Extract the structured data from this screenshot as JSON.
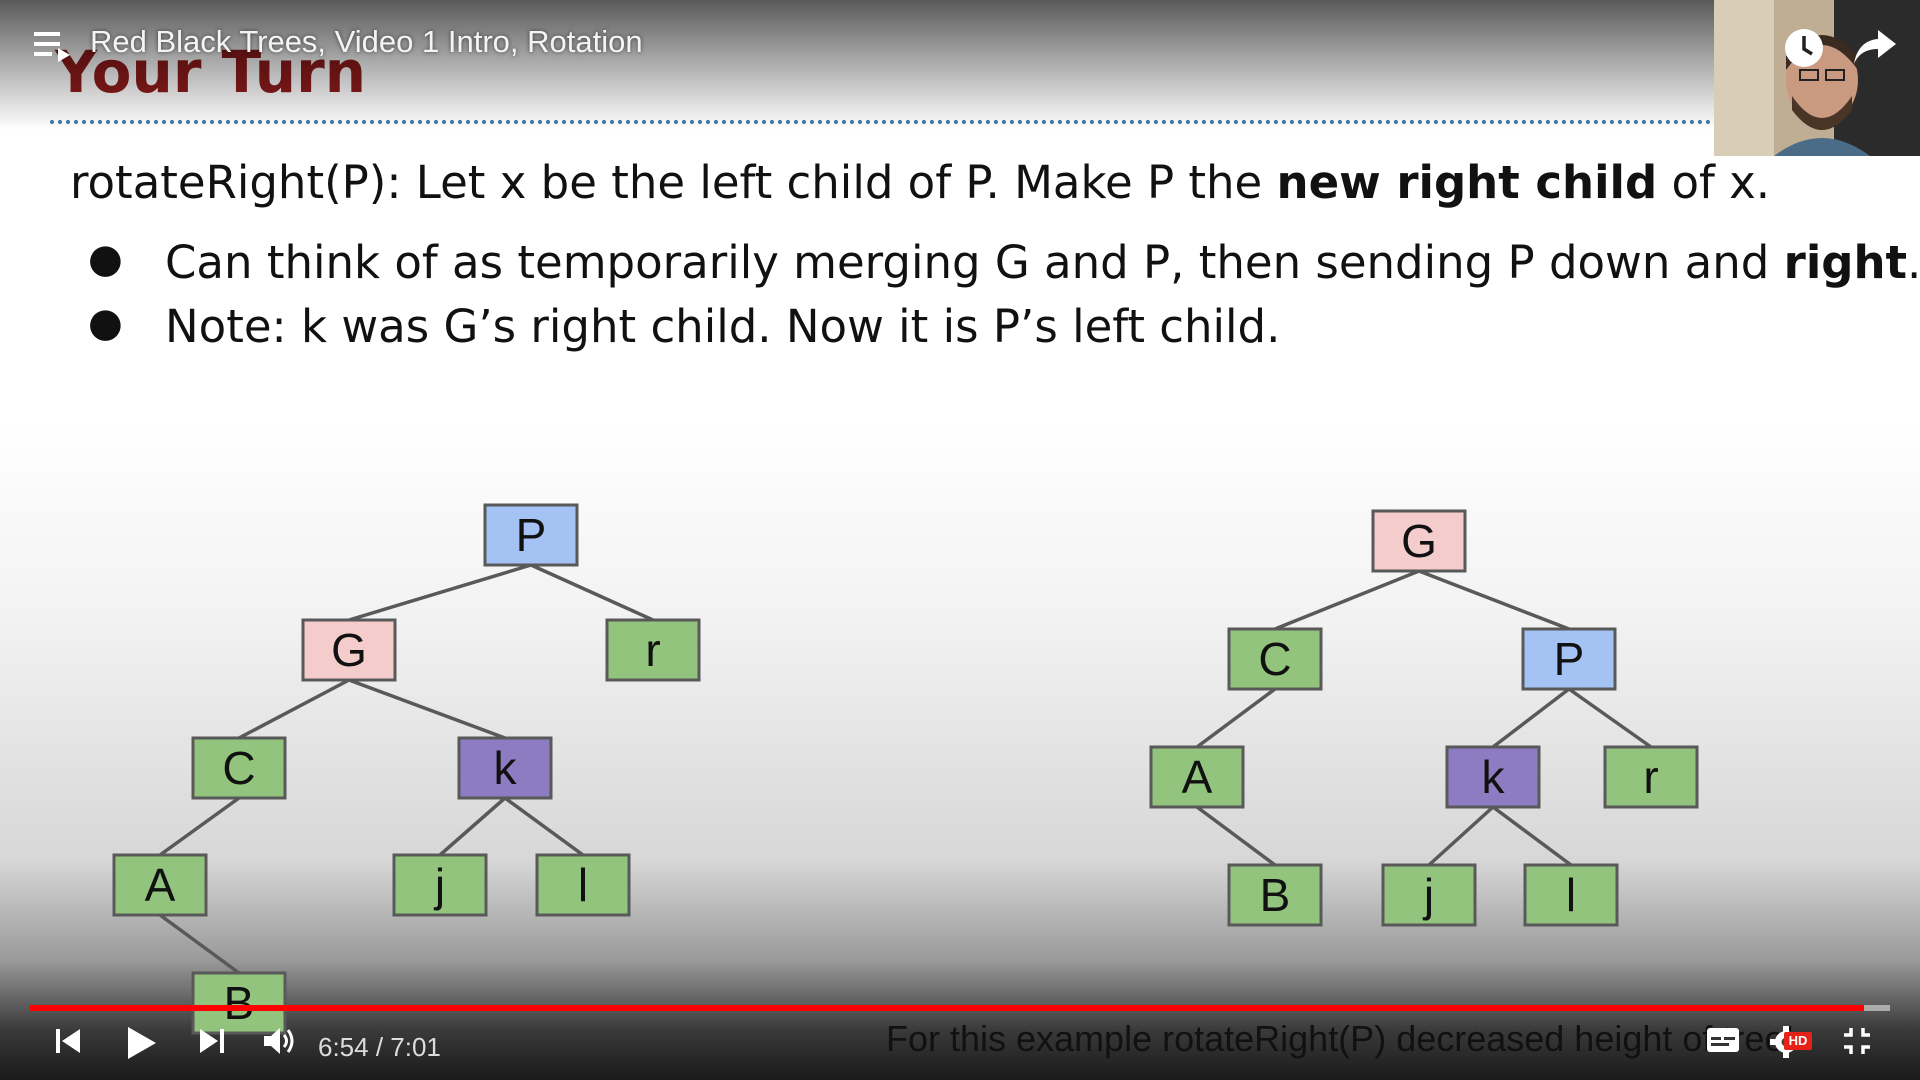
{
  "player": {
    "video_title": "Red Black Trees, Video 1 Intro, Rotation",
    "time_display": "6:54 / 7:01",
    "progress_fraction": 0.9858,
    "hd_badge": "HD",
    "caption": "For this example rotateRight(P) decreased height of tree!",
    "accent_color": "#ff0000"
  },
  "slide": {
    "heading": "Your Turn",
    "main_line": {
      "pre": "rotateRight(P): Let x be the left child of P. Make P the ",
      "bold": "new right child",
      "post": " of x."
    },
    "bullets": [
      {
        "pre": "Can think of as temporarily merging G and P, then sending P down and ",
        "bold": "right",
        "post": "."
      },
      {
        "pre": "Note: k was G’s right child. Now it is P’s left child.",
        "bold": "",
        "post": ""
      }
    ],
    "bullet_glyph": "●"
  },
  "trees": {
    "colors": {
      "blue": "#a4c2f4",
      "pink": "#f4cccc",
      "green": "#93c47d",
      "purple": "#8e7cc3"
    },
    "before": {
      "nodes": [
        {
          "id": "P",
          "label": "P",
          "color": "blue"
        },
        {
          "id": "G",
          "label": "G",
          "color": "pink"
        },
        {
          "id": "r",
          "label": "r",
          "color": "green"
        },
        {
          "id": "C",
          "label": "C",
          "color": "green"
        },
        {
          "id": "k",
          "label": "k",
          "color": "purple"
        },
        {
          "id": "A",
          "label": "A",
          "color": "green"
        },
        {
          "id": "j",
          "label": "j",
          "color": "green"
        },
        {
          "id": "l",
          "label": "l",
          "color": "green"
        },
        {
          "id": "B",
          "label": "B",
          "color": "green"
        }
      ],
      "edges": [
        [
          "P",
          "G"
        ],
        [
          "P",
          "r"
        ],
        [
          "G",
          "C"
        ],
        [
          "G",
          "k"
        ],
        [
          "C",
          "A"
        ],
        [
          "k",
          "j"
        ],
        [
          "k",
          "l"
        ],
        [
          "A",
          "B"
        ]
      ]
    },
    "after": {
      "nodes": [
        {
          "id": "G",
          "label": "G",
          "color": "pink"
        },
        {
          "id": "C",
          "label": "C",
          "color": "green"
        },
        {
          "id": "P",
          "label": "P",
          "color": "blue"
        },
        {
          "id": "A",
          "label": "A",
          "color": "green"
        },
        {
          "id": "k",
          "label": "k",
          "color": "purple"
        },
        {
          "id": "r",
          "label": "r",
          "color": "green"
        },
        {
          "id": "B",
          "label": "B",
          "color": "green"
        },
        {
          "id": "j",
          "label": "j",
          "color": "green"
        },
        {
          "id": "l",
          "label": "l",
          "color": "green"
        }
      ],
      "edges": [
        [
          "G",
          "C"
        ],
        [
          "G",
          "P"
        ],
        [
          "C",
          "A"
        ],
        [
          "A",
          "B"
        ],
        [
          "P",
          "k"
        ],
        [
          "P",
          "r"
        ],
        [
          "k",
          "j"
        ],
        [
          "k",
          "l"
        ]
      ]
    }
  },
  "icons": {
    "playlist": "playlist-icon",
    "watch_later": "clock-icon",
    "share": "share-arrow-icon",
    "prev": "skip-previous-icon",
    "play": "play-icon",
    "next": "skip-next-icon",
    "volume": "volume-icon",
    "subtitles": "subtitles-icon",
    "settings": "gear-icon",
    "fullscreen": "exit-fullscreen-icon"
  }
}
